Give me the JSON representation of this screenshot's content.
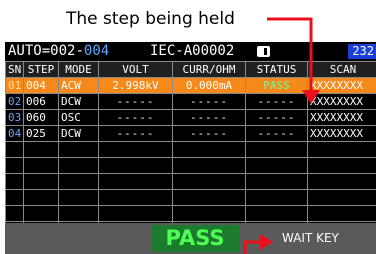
{
  "annotations": {
    "held_step_label": "The step being held"
  },
  "topbar": {
    "mode_prefix": "AUTO=",
    "total_steps": "002",
    "separator": "-",
    "current_step": "004",
    "test_name": "IEC-A00002",
    "memory_badge": "232"
  },
  "table": {
    "headers": [
      "SN",
      "STEP",
      "MODE",
      "VOLT",
      "CURR/OHM",
      "STATUS",
      "SCAN"
    ],
    "rows": [
      {
        "sn": "01",
        "step": "004",
        "mode": "ACW",
        "volt": "2.998kV",
        "curr": "0.000mA",
        "status": "PASS",
        "scan": "XXXXXXXX"
      },
      {
        "sn": "02",
        "step": "006",
        "mode": "DCW",
        "volt": "-----",
        "curr": "-----",
        "status": "-----",
        "scan": "XXXXXXXX"
      },
      {
        "sn": "03",
        "step": "060",
        "mode": "OSC",
        "volt": "-----",
        "curr": "-----",
        "status": "-----",
        "scan": "XXXXXXXX"
      },
      {
        "sn": "04",
        "step": "025",
        "mode": "DCW",
        "volt": "-----",
        "curr": "-----",
        "status": "-----",
        "scan": "XXXXXXXX"
      }
    ],
    "empty_rows": 6
  },
  "bottombar": {
    "result": "PASS",
    "wait_key_label": "WAIT KEY"
  },
  "colors": {
    "held_row": "#f58a1a",
    "pass_green": "#4cff52",
    "pass_bg": "#1c7c2e",
    "step_blue": "#6aa6ff",
    "annotation_red": "#e8101a",
    "badge_blue": "#1a3fd6"
  }
}
